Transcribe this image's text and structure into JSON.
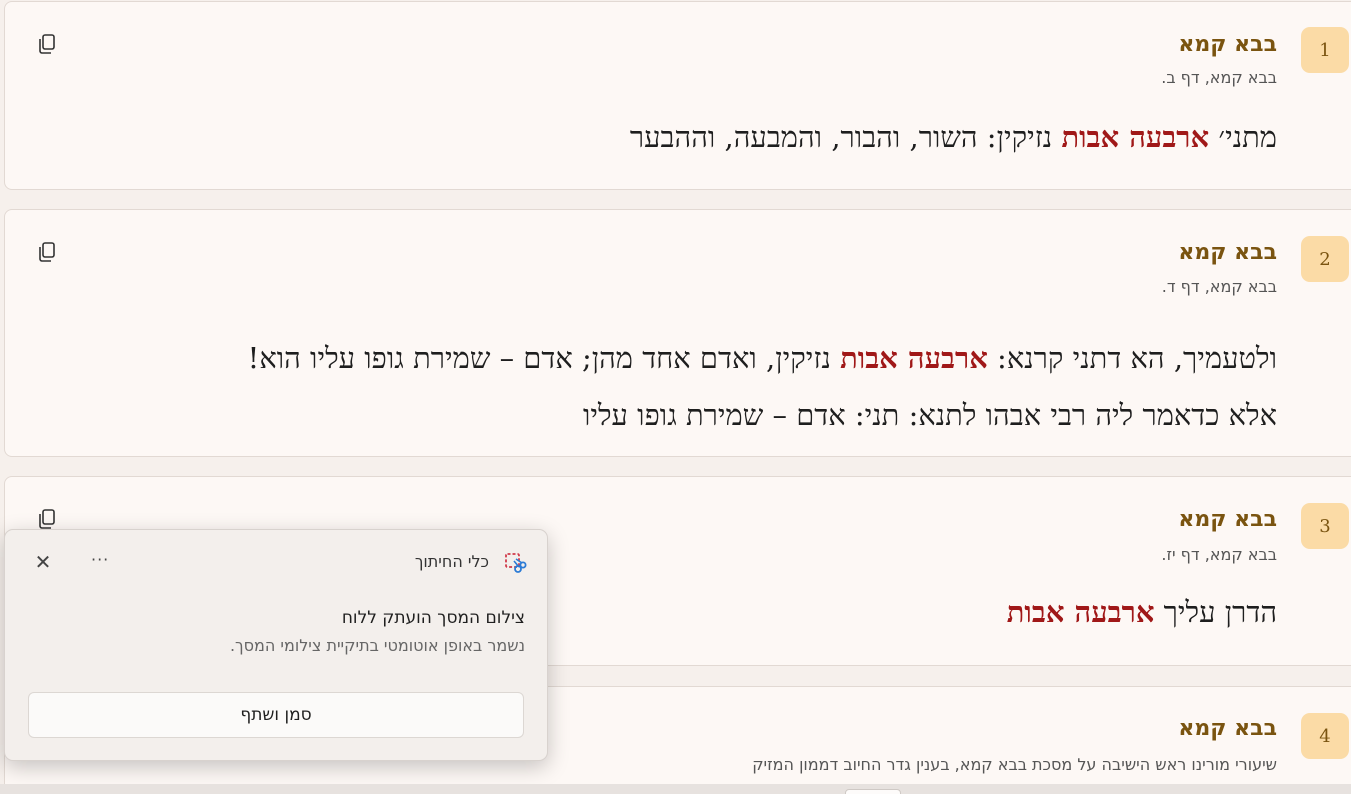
{
  "results": [
    {
      "number": "1",
      "title": "בבא קמא",
      "source": "בבא קמא, דף ב.",
      "lines": [
        [
          {
            "text": "מתני׳ ",
            "hl": false
          },
          {
            "text": "ארבעה אבות",
            "hl": true
          },
          {
            "text": " נזיקין: השור, והבור, והמבעה, וההבער",
            "hl": false
          }
        ]
      ]
    },
    {
      "number": "2",
      "title": "בבא קמא",
      "source": "בבא קמא, דף ד.",
      "lines": [
        [
          {
            "text": "ולטעמיך, הא דתני קרנא: ",
            "hl": false
          },
          {
            "text": "ארבעה אבות",
            "hl": true
          },
          {
            "text": " נזיקין, ואדם אחד מהן; אדם – שמירת גופו עליו הוא!",
            "hl": false
          }
        ],
        [
          {
            "text": "אלא כדאמר ליה רבי אבהו לתנא: תני: אדם – שמירת גופו עליו",
            "hl": false
          }
        ]
      ]
    },
    {
      "number": "3",
      "title": "בבא קמא",
      "source": "בבא קמא, דף יז.",
      "lines": [
        [
          {
            "text": "הדרן עליך ",
            "hl": false
          },
          {
            "text": "ארבעה אבות",
            "hl": true
          }
        ]
      ]
    },
    {
      "number": "4",
      "title": "בבא קמא",
      "source": "שיעורי מורינו ראש הישיבה על מסכת בבא קמא, בענין גדר החיוב דממון המזיק",
      "lines": []
    }
  ],
  "toast": {
    "app_name": "כלי החיתוך",
    "more_label": "···",
    "close_label": "✕",
    "heading": "צילום המסך הועתק ללוח",
    "body": "נשמר באופן אוטומטי בתיקיית צילומי המסך.",
    "button_label": "סמן ושתף"
  },
  "icons": {
    "copy": "copy-icon",
    "snip": "snipping-tool-icon",
    "close": "close-icon",
    "more": "more-icon"
  },
  "colors": {
    "highlight": "#a01818",
    "title": "#7a5410",
    "badge": "#fbdba6"
  }
}
